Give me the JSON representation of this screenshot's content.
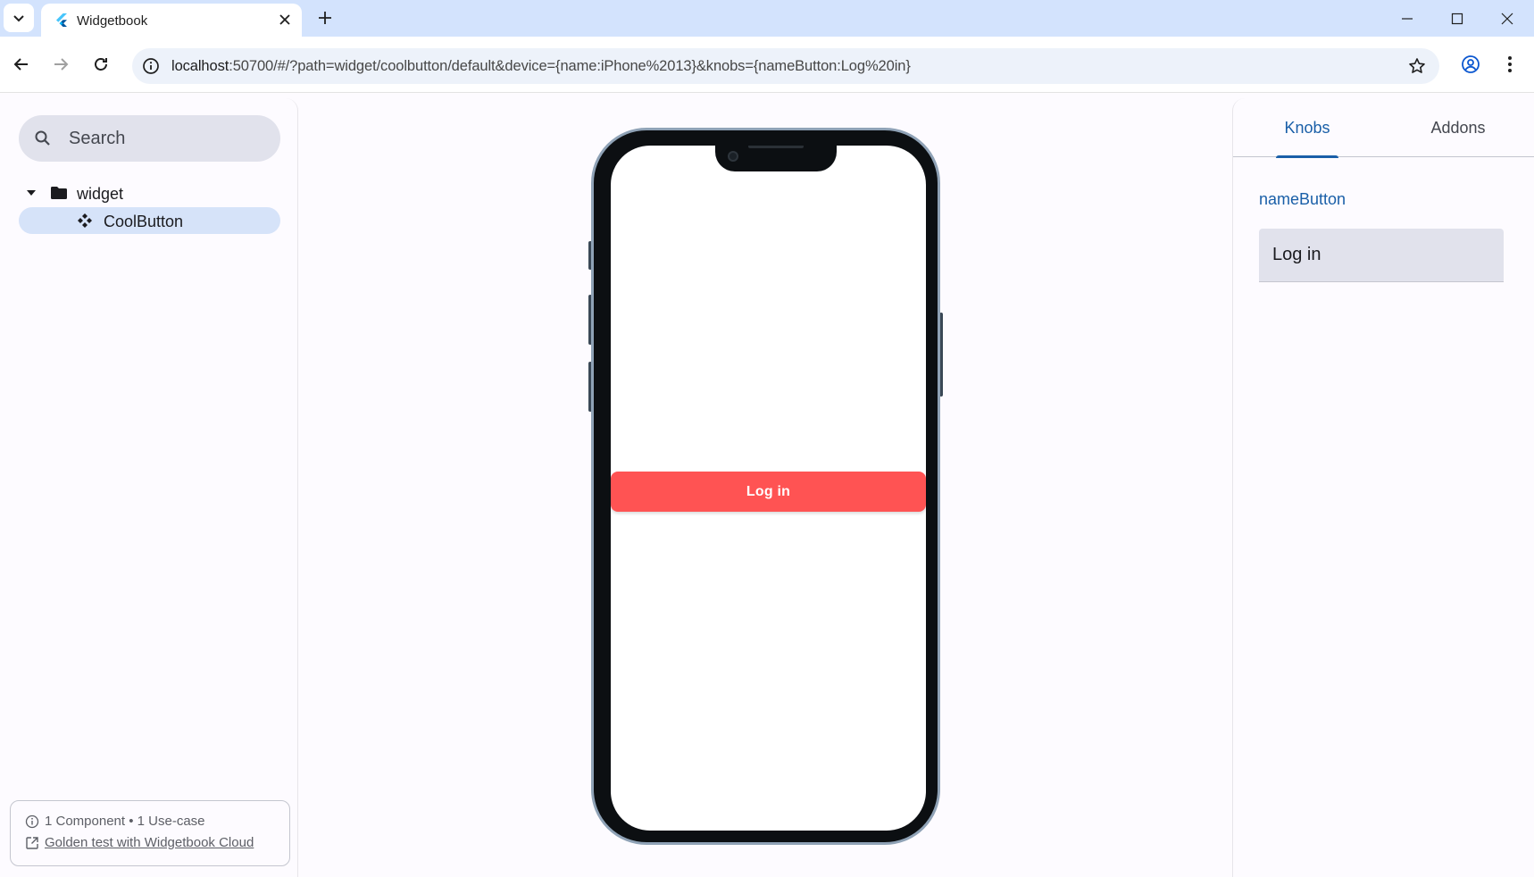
{
  "browser": {
    "tab_title": "Widgetbook",
    "url_host": "localhost",
    "url_rest": ":50700/#/?path=widget/coolbutton/default&device={name:iPhone%2013}&knobs={nameButton:Log%20in}"
  },
  "sidebar": {
    "search_placeholder": "Search",
    "tree": {
      "folder_label": "widget",
      "component_label": "CoolButton"
    },
    "footer": {
      "stats": "1 Component • 1 Use-case",
      "link": "Golden test with Widgetbook Cloud"
    }
  },
  "preview": {
    "button_label": "Log in",
    "button_color": "#ff5353"
  },
  "knobs_panel": {
    "tab_knobs": "Knobs",
    "tab_addons": "Addons",
    "knob_name": "nameButton",
    "knob_value": "Log in"
  },
  "colors": {
    "accent": "#1a5fa8",
    "chrome": "#d3e3fd",
    "selected_item": "#d6e3f9"
  },
  "icons": {
    "tab_menu": "chevron-down-icon",
    "favicon": "flutter-icon",
    "close": "close-icon",
    "new_tab": "plus-icon",
    "back": "arrow-left-icon",
    "forward": "arrow-right-icon",
    "reload": "reload-icon",
    "site_info": "info-icon",
    "bookmark": "star-icon",
    "profile": "profile-icon",
    "menu": "kebab-icon",
    "search": "search-icon",
    "folder": "folder-icon",
    "component": "component-icon",
    "info": "info-icon",
    "external_link": "external-link-icon"
  }
}
